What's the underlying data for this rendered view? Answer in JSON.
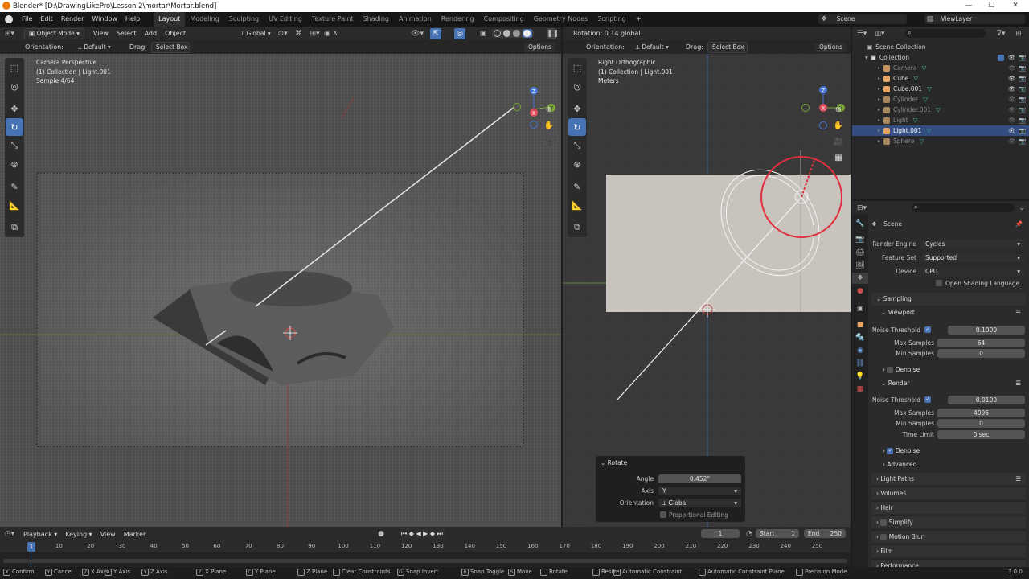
{
  "window": {
    "title": "Blender* [D:\\DrawingLikePro\\Lesson 2\\mortar\\Mortar.blend]",
    "minimize": "—",
    "maximize": "☐",
    "close": "✕"
  },
  "menu": [
    "File",
    "Edit",
    "Render",
    "Window",
    "Help"
  ],
  "workspaces": [
    "Layout",
    "Modeling",
    "Sculpting",
    "UV Editing",
    "Texture Paint",
    "Shading",
    "Animation",
    "Rendering",
    "Compositing",
    "Geometry Nodes",
    "Scripting"
  ],
  "workspace_add": "+",
  "scene": {
    "label": "Scene",
    "viewlayer": "ViewLayer"
  },
  "v3d_header": {
    "mode": "Object Mode",
    "menus": [
      "View",
      "Select",
      "Add",
      "Object"
    ],
    "orientation": "Global"
  },
  "tool_header": {
    "orientation_label": "Orientation:",
    "orientation_value": "Default",
    "drag_label": "Drag:",
    "drag_value": "Select Box",
    "options": "Options"
  },
  "left_viewport": {
    "overlay": [
      "Camera Perspective",
      "(1) Collection | Light.001",
      "Sample 4/64"
    ],
    "gizmo": {
      "x": "X",
      "y": "Y",
      "z": "Z"
    }
  },
  "right_header": {
    "status": "Rotation: 0.14 global"
  },
  "right_viewport": {
    "overlay": [
      "Right Orthographic",
      "(1) Collection | Light.001",
      "Meters"
    ],
    "gizmo": {
      "x": "X",
      "y": "Y",
      "z": "Z"
    }
  },
  "redo_panel": {
    "title": "Rotate",
    "angle_label": "Angle",
    "angle_value": "0.452°",
    "axis_label": "Axis",
    "axis_value": "Y",
    "orientation_label": "Orientation",
    "orientation_value": "Global",
    "proportional_label": "Proportional Editing"
  },
  "outliner": {
    "search_placeholder": "",
    "root": "Scene Collection",
    "collection": "Collection",
    "items": [
      {
        "name": "Camera",
        "color": "#c7955d"
      },
      {
        "name": "Cube",
        "color": "#e8a561"
      },
      {
        "name": "Cube.001",
        "color": "#e8a561"
      },
      {
        "name": "Cylinder",
        "color": "#a8875c"
      },
      {
        "name": "Cylinder.001",
        "color": "#a8875c"
      },
      {
        "name": "Light",
        "color": "#a8875c"
      },
      {
        "name": "Light.001",
        "color": "#e8a561"
      },
      {
        "name": "Sphere",
        "color": "#a8875c"
      }
    ]
  },
  "properties": {
    "context": "Scene",
    "render_engine_label": "Render Engine",
    "render_engine": "Cycles",
    "feature_set_label": "Feature Set",
    "feature_set": "Supported",
    "device_label": "Device",
    "device": "CPU",
    "osl_label": "Open Shading Language",
    "sampling": "Sampling",
    "viewport": "Viewport",
    "vp_noise_label": "Noise Threshold",
    "vp_noise": "0.1000",
    "vp_max_label": "Max Samples",
    "vp_max": "64",
    "vp_min_label": "Min Samples",
    "vp_min": "0",
    "vp_denoise": "Denoise",
    "render": "Render",
    "r_noise_label": "Noise Threshold",
    "r_noise": "0.0100",
    "r_max_label": "Max Samples",
    "r_max": "4096",
    "r_min_label": "Min Samples",
    "r_min": "0",
    "r_time_label": "Time Limit",
    "r_time": "0 sec",
    "r_denoise": "Denoise",
    "advanced": "Advanced",
    "panels": [
      "Light Paths",
      "Volumes",
      "Hair",
      "Simplify",
      "Motion Blur",
      "Film",
      "Performance"
    ]
  },
  "timeline": {
    "menus": [
      "Playback",
      "Keying",
      "View",
      "Marker"
    ],
    "current": "1",
    "start_label": "Start",
    "start": "1",
    "end_label": "End",
    "end": "250",
    "ticks": [
      "1",
      "10",
      "20",
      "30",
      "40",
      "50",
      "60",
      "70",
      "80",
      "90",
      "100",
      "110",
      "120",
      "130",
      "140",
      "150",
      "160",
      "170",
      "180",
      "190",
      "200",
      "210",
      "220",
      "230",
      "240",
      "250"
    ]
  },
  "statusbar": {
    "items": [
      "Confirm",
      "Cancel",
      "X Axis",
      "Y Axis",
      "Z Axis",
      "X Plane",
      "Y Plane",
      "Z Plane",
      "Clear Constraints",
      "Snap Invert",
      "Snap Toggle",
      "Move",
      "Rotate",
      "Resize",
      "Automatic Constraint",
      "Automatic Constraint Plane",
      "Precision Mode"
    ],
    "keys": [
      "X",
      "Y",
      "Z",
      "X",
      "Y",
      "Z",
      "C",
      "",
      "",
      "G",
      "R",
      "S",
      "",
      "",
      ""
    ],
    "version": "3.0.0"
  }
}
